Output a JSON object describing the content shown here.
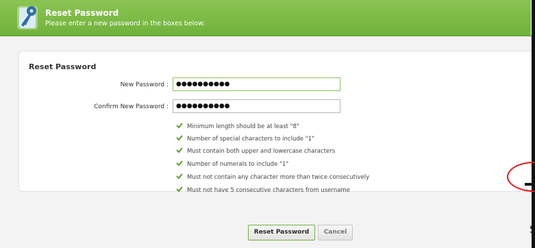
{
  "header": {
    "title": "Reset Password",
    "subtitle": "Please enter a new password in the boxes below:"
  },
  "form": {
    "section_title": "Reset Password",
    "new_password": {
      "label": "New Password :",
      "value": "●●●●●●●●●●"
    },
    "confirm_password": {
      "label": "Confirm New Password :",
      "value": "●●●●●●●●●●"
    },
    "rules": [
      "Minimum length should be at least \"8\"",
      "Number of special characters to include \"1\"",
      "Must contain both upper and lowercase characters",
      "Number of numerals to include \"1\"",
      "Must not contain any character more than twice consecutively",
      "Must not have 5 consecutive characters from username"
    ]
  },
  "buttons": {
    "reset_label": "Reset Password",
    "cancel_label": "Cancel"
  },
  "overlay": {
    "cut_text": "S"
  },
  "colors": {
    "header_green": "#7cbb47",
    "check_green": "#5aa02c",
    "annotation_red": "#e21818"
  }
}
